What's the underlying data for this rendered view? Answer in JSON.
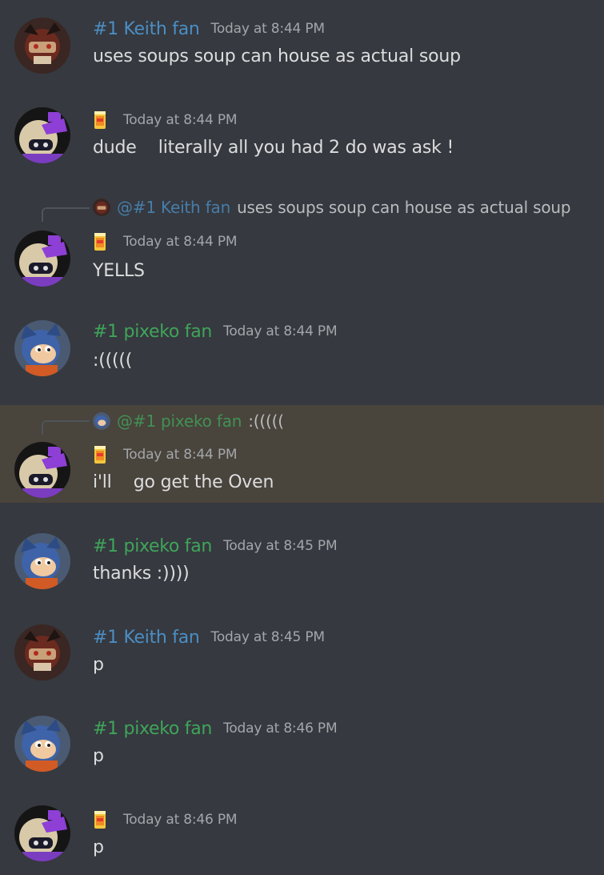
{
  "colors": {
    "background": "#36393f",
    "highlight": "#49443c",
    "keith": "#4b8ec4",
    "pixeko": "#3fa55a",
    "timestamp": "#a3a6aa",
    "text": "#dcddde"
  },
  "users": {
    "keith": {
      "name": "#1 Keith fan",
      "mention": "@#1 Keith fan",
      "avatar_icon": "dark-hedgehog-avatar-icon"
    },
    "pixeko": {
      "name": "#1 pixeko fan",
      "mention": "@#1 pixeko fan",
      "avatar_icon": "blue-hedgehog-avatar-icon"
    },
    "third": {
      "name": "",
      "avatar_icon": "purple-hat-avatar-icon",
      "badge_icon": "juice-glass-icon"
    }
  },
  "messages": [
    {
      "author": "keith",
      "timestamp": "Today at 8:44 PM",
      "text": "uses soups soup can house as actual soup"
    },
    {
      "author": "third",
      "timestamp": "Today at 8:44 PM",
      "text": "dude    literally all you had 2 do was ask !"
    },
    {
      "author": "third",
      "timestamp": "Today at 8:44 PM",
      "text": "YELLS",
      "reply": {
        "to": "keith",
        "text": "uses soups soup can house as actual soup"
      }
    },
    {
      "author": "pixeko",
      "timestamp": "Today at 8:44 PM",
      "text": ":((((("
    },
    {
      "author": "third",
      "timestamp": "Today at 8:44 PM",
      "text": "i'll    go get the Oven",
      "highlighted": true,
      "reply": {
        "to": "pixeko",
        "text": ":((((("
      }
    },
    {
      "author": "pixeko",
      "timestamp": "Today at 8:45 PM",
      "text": "thanks :))))"
    },
    {
      "author": "keith",
      "timestamp": "Today at 8:45 PM",
      "text": "p"
    },
    {
      "author": "pixeko",
      "timestamp": "Today at 8:46 PM",
      "text": "p"
    },
    {
      "author": "third",
      "timestamp": "Today at 8:46 PM",
      "text": "p"
    }
  ]
}
